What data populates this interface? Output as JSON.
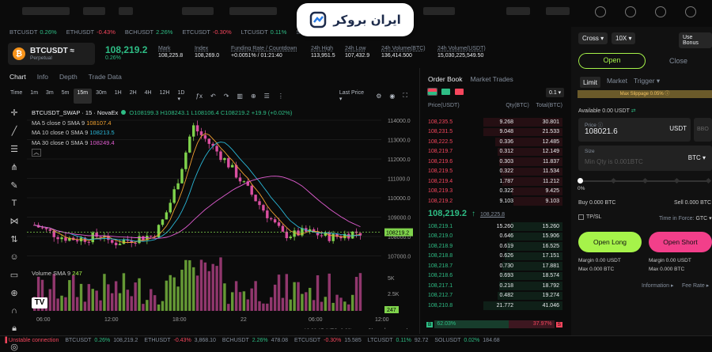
{
  "watermark": {
    "text": "ایران بروکر"
  },
  "ticker": [
    {
      "sym": "BTCUSDT",
      "chg": "0.26%",
      "up": true
    },
    {
      "sym": "ETHUSDT",
      "chg": "-0.43%",
      "up": false
    },
    {
      "sym": "BCHUSDT",
      "chg": "2.26%",
      "up": true
    },
    {
      "sym": "ETCUSDT",
      "chg": "-0.30%",
      "up": false
    },
    {
      "sym": "LTCUSDT",
      "chg": "0.11%",
      "up": true
    },
    {
      "sym": "SOL",
      "chg": "",
      "up": true
    }
  ],
  "symbol": {
    "name": "BTCUSDT ≈",
    "sub": "Perpetual",
    "coin": "₿"
  },
  "last": {
    "price": "108,219.2",
    "change": "0.26%"
  },
  "stats": [
    {
      "label": "Mark",
      "value": "108,225.8"
    },
    {
      "label": "Index",
      "value": "108,269.0"
    },
    {
      "label": "Funding Rate / Countdown",
      "value": "+0.0051% / 01:21:40"
    },
    {
      "label": "24h High",
      "value": "113,951.5"
    },
    {
      "label": "24h Low",
      "value": "107,432.9"
    },
    {
      "label": "24h Volume(BTC)",
      "value": "136,414.500"
    },
    {
      "label": "24h Volume(USDT)",
      "value": "15,030,225,549.50"
    }
  ],
  "chart_tabs": [
    "Chart",
    "Info",
    "Depth",
    "Trade Data"
  ],
  "toolbar": {
    "intervals": [
      "Time",
      "1m",
      "3m",
      "5m",
      "15m",
      "30m",
      "1H",
      "2H",
      "4H",
      "12H",
      "1D ▾"
    ],
    "price_mode": "Last Price ▾"
  },
  "legend": {
    "title": "BTCUSDT_SWAP · 15 · NovaEx",
    "ohlc": "O108199.3  H108243.1  L108106.4  C108219.2  +19.9 (+0.02%)",
    "ma5": {
      "label": "MA 5 close 0 SMA 9",
      "value": "108107.4"
    },
    "ma10": {
      "label": "MA 10 close 0 SMA 9",
      "value": "108213.5"
    },
    "ma30": {
      "label": "MA 30 close 0 SMA 9",
      "value": "108249.4"
    },
    "vol": {
      "label": "Volume SMA 9",
      "value": "247"
    }
  },
  "chart_data": {
    "type": "candlestick",
    "y_ticks": [
      "114000.0",
      "113000.0",
      "112000.0",
      "111000.0",
      "110000.0",
      "109000.0",
      "108000.0",
      "107000.0"
    ],
    "vol_ticks": [
      "5K",
      "2.5K"
    ],
    "x_ticks": [
      "06:00",
      "12:00",
      "18:00",
      "22",
      "06:00",
      "12:00"
    ],
    "last_label": "108219.2",
    "vol_label": "247",
    "footer_time": "10:08:17 (UTC+3:30)",
    "scale_opts": [
      "%",
      "log",
      "auto"
    ]
  },
  "orderbook": {
    "tabs": [
      "Order Book",
      "Market Trades"
    ],
    "precision": "0.1 ▾",
    "headers": [
      "Price(USDT)",
      "Qty(BTC)",
      "Total(BTC)"
    ],
    "asks": [
      [
        "108,235.5",
        "9.268",
        "30.801"
      ],
      [
        "108,231.5",
        "9.048",
        "21.533"
      ],
      [
        "108,222.5",
        "0.336",
        "12.485"
      ],
      [
        "108,219.7",
        "0.312",
        "12.149"
      ],
      [
        "108,219.6",
        "0.303",
        "11.837"
      ],
      [
        "108,219.5",
        "0.322",
        "11.534"
      ],
      [
        "108,219.4",
        "1.787",
        "11.212"
      ],
      [
        "108,219.3",
        "0.322",
        "9.425"
      ],
      [
        "108,219.2",
        "9.103",
        "9.103"
      ]
    ],
    "mid": {
      "price": "108,219.2",
      "arrow": "↑",
      "mark": "108,225.8"
    },
    "bids": [
      [
        "108,219.1",
        "15.260",
        "15.260"
      ],
      [
        "108,219.0",
        "0.646",
        "15.906"
      ],
      [
        "108,218.9",
        "0.619",
        "16.525"
      ],
      [
        "108,218.8",
        "0.626",
        "17.151"
      ],
      [
        "108,218.7",
        "0.730",
        "17.881"
      ],
      [
        "108,218.6",
        "0.693",
        "18.574"
      ],
      [
        "108,217.1",
        "0.218",
        "18.792"
      ],
      [
        "108,212.7",
        "0.482",
        "19.274"
      ],
      [
        "108,210.8",
        "21.772",
        "41.046"
      ]
    ],
    "buy_pct": "62.03%",
    "sell_pct": "37.97%",
    "b": "B",
    "s": "S"
  },
  "order": {
    "margin_mode": "Cross ▾",
    "leverage": "10X ▾",
    "bonus": "Use Bonus",
    "open": "Open",
    "close": "Close",
    "types": [
      "Limit",
      "Market",
      "Trigger ▾"
    ],
    "slippage": "Max Slippage 0.05% ⓘ",
    "available": "Available 0.00 USDT",
    "price_label": "Price ⓘ",
    "price_value": "108021.6",
    "price_unit": "USDT",
    "bbo": "BBO",
    "size_label": "Size",
    "size_placeholder": "Min Qty is 0.001BTC",
    "size_unit": "BTC ▾",
    "slider_pct": "0%",
    "buy": "Buy 0.000 BTC",
    "sell": "Sell 0.000 BTC",
    "tpsl": "TP/SL",
    "tif_label": "Time in Force:",
    "tif_value": "GTC ▾",
    "long": "Open Long",
    "short": "Open Short",
    "long_margin": "Margin  0.00 USDT",
    "long_max": "Max  0.000 BTC",
    "short_margin": "Margin  0.00 USDT",
    "short_max": "Max  0.000 BTC",
    "info": "Information ▸",
    "fee": "Fee Rate ▸"
  },
  "footer": {
    "status": "Unstable connection",
    "items": [
      {
        "sym": "BTCUSDT",
        "chg": "0.26%",
        "price": "108,219.2",
        "up": true
      },
      {
        "sym": "ETHUSDT",
        "chg": "-0.43%",
        "price": "3,868.10",
        "up": false
      },
      {
        "sym": "BCHUSDT",
        "chg": "2.26%",
        "price": "478.08",
        "up": true
      },
      {
        "sym": "ETCUSDT",
        "chg": "-0.30%",
        "price": "15.585",
        "up": false
      },
      {
        "sym": "LTCUSDT",
        "chg": "0.11%",
        "price": "92.72",
        "up": true
      },
      {
        "sym": "SOLUSDT",
        "chg": "0.02%",
        "price": "184.68",
        "up": true
      }
    ]
  }
}
